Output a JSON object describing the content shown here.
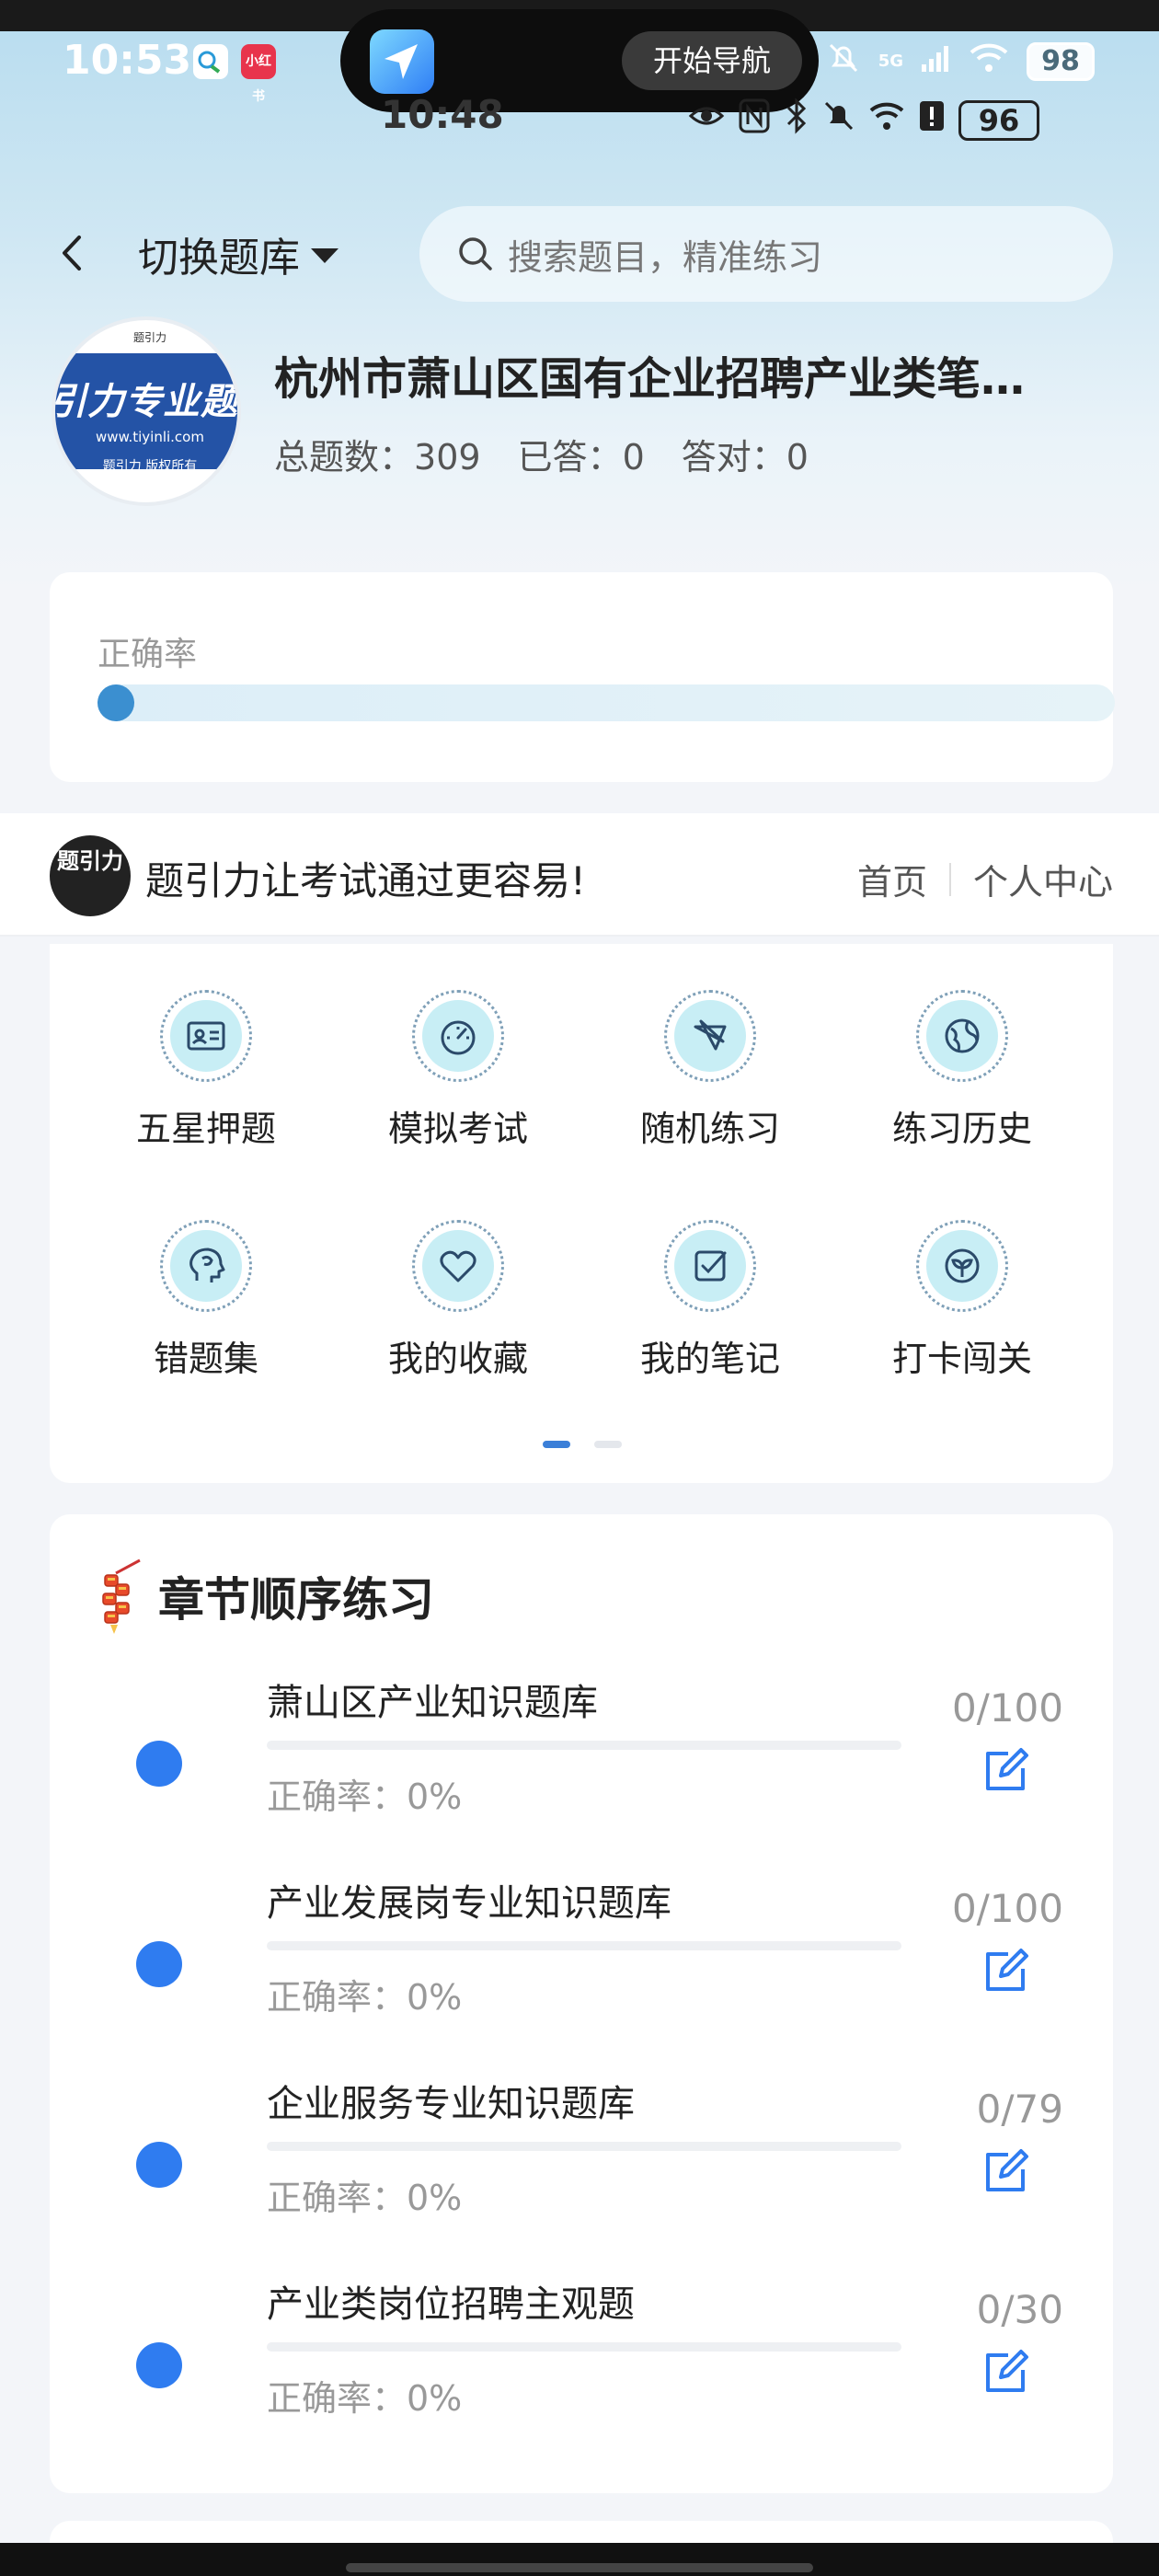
{
  "status_bar": {
    "time": "10:53",
    "mini_app_label": "小红书",
    "network": "5G",
    "battery": "98"
  },
  "island": {
    "button_label": "开始导航"
  },
  "inner_status": {
    "time": "10:48",
    "battery": "96"
  },
  "header": {
    "switch_label": "切换题库",
    "search_placeholder": "搜索题目，精准练习"
  },
  "bank": {
    "logo_text": "引力专业题",
    "logo_header": "题引力",
    "logo_url": "www.tiyinli.com",
    "logo_copyright": "题引力 版权所有",
    "title": "杭州市萧山区国有企业招聘产业类笔…",
    "total_label": "总题数：",
    "total_value": "309",
    "answered_label": "已答：",
    "answered_value": "0",
    "correct_label": "答对：",
    "correct_value": "0"
  },
  "accuracy": {
    "label": "正确率",
    "value_fraction": 0
  },
  "banner": {
    "logo_text": "题引力",
    "slogan": "题引力让考试通过更容易!",
    "nav_home": "首页",
    "nav_profile": "个人中心"
  },
  "grid": {
    "items": [
      {
        "label": "五星押题",
        "icon": "id-card-icon"
      },
      {
        "label": "模拟考试",
        "icon": "gauge-icon"
      },
      {
        "label": "随机练习",
        "icon": "random-icon"
      },
      {
        "label": "练习历史",
        "icon": "globe-icon"
      },
      {
        "label": "错题集",
        "icon": "head-icon"
      },
      {
        "label": "我的收藏",
        "icon": "heart-icon"
      },
      {
        "label": "我的笔记",
        "icon": "note-check-icon"
      },
      {
        "label": "打卡闯关",
        "icon": "sprout-icon"
      }
    ],
    "page_index": 1,
    "page_count": 2
  },
  "chapters": {
    "title": "章节顺序练习",
    "items": [
      {
        "name": "萧山区产业知识题库",
        "rate": "正确率：0%",
        "count": "0/100"
      },
      {
        "name": "产业发展岗专业知识题库",
        "rate": "正确率：0%",
        "count": "0/100"
      },
      {
        "name": "企业服务专业知识题库",
        "rate": "正确率：0%",
        "count": "0/79"
      },
      {
        "name": "产业类岗位招聘主观题",
        "rate": "正确率：0%",
        "count": "0/30"
      }
    ]
  },
  "colors": {
    "accent": "#2f7cf0",
    "icon_bg": "#c8eef5"
  }
}
